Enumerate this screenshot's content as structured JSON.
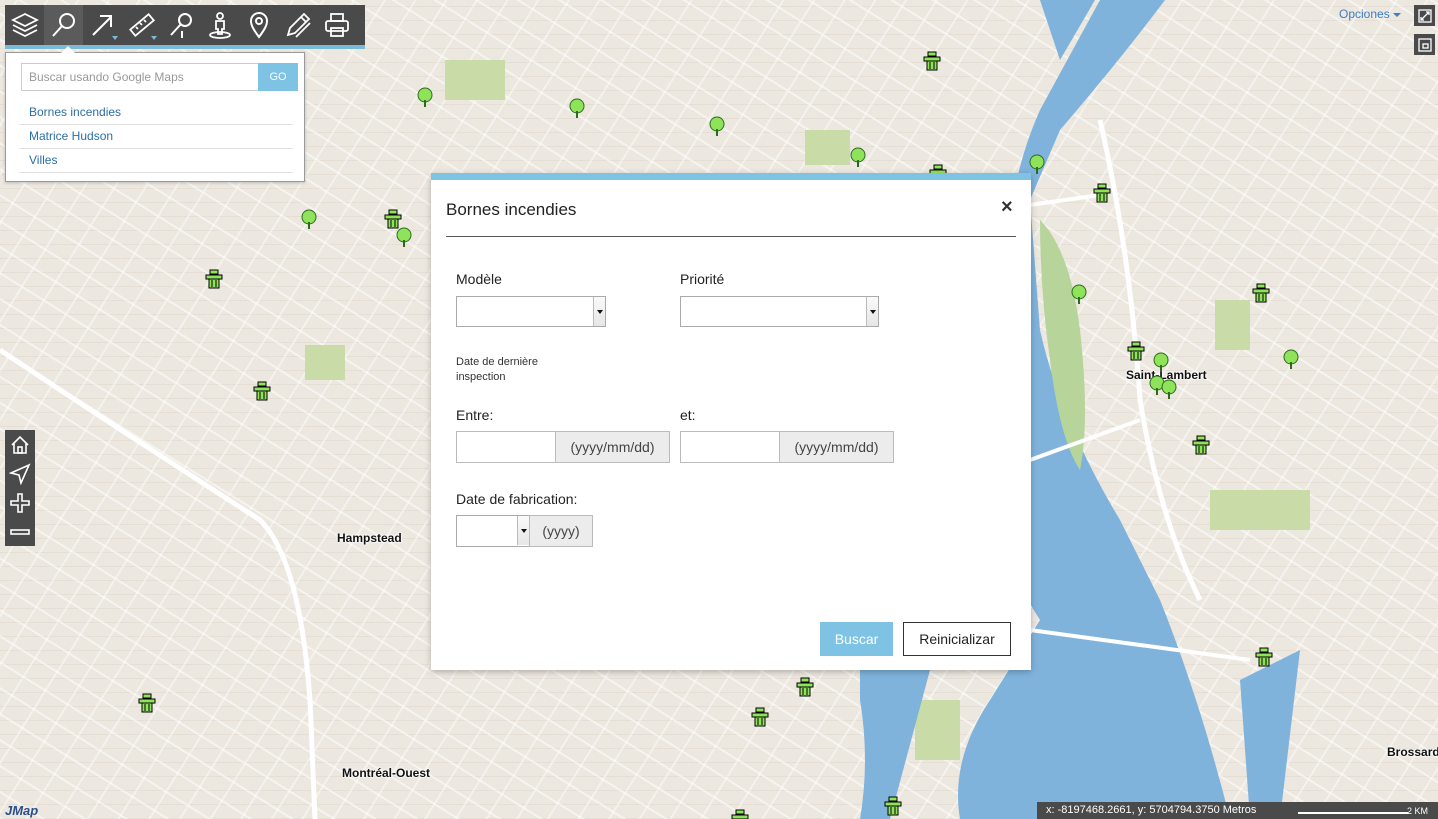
{
  "toolbar": {
    "tools": [
      {
        "name": "layers-icon"
      },
      {
        "name": "search-icon"
      },
      {
        "name": "select-arrow-icon"
      },
      {
        "name": "measure-ruler-icon"
      },
      {
        "name": "geocode-search-icon"
      },
      {
        "name": "street-view-icon"
      },
      {
        "name": "location-pin-icon"
      },
      {
        "name": "draw-pencil-icon"
      },
      {
        "name": "print-icon"
      }
    ]
  },
  "search_panel": {
    "placeholder": "Buscar usando Google Maps",
    "go_label": "GO",
    "items": [
      "Bornes incendies",
      "Matrice Hudson",
      "Villes"
    ]
  },
  "top_right": {
    "opciones_label": "Opciones"
  },
  "map": {
    "labels": [
      "Hampstead",
      "Montréal-Ouest",
      "Saint-Lambert",
      "Brossard"
    ]
  },
  "status": {
    "coordinates": "x: -8197468.2661, y: 5704794.3750 Metros",
    "scale_label": "2 KM",
    "logo": "JMap"
  },
  "dialog": {
    "title": "Bornes incendies",
    "close_symbol": "×",
    "modele_label": "Modèle",
    "priorite_label": "Priorité",
    "inspection_label": "Date de dernière inspection",
    "entre_label": "Entre:",
    "et_label": "et:",
    "date_format": "(yyyy/mm/dd)",
    "fabrication_label": "Date de fabrication:",
    "year_format": "(yyyy)",
    "buscar_label": "Buscar",
    "reset_label": "Reinicializar"
  },
  "colors": {
    "accent": "#7ec3e4",
    "toolbar": "#4a4a4a",
    "river": "#7fb3dc",
    "marker_green": "#8ee35a"
  }
}
